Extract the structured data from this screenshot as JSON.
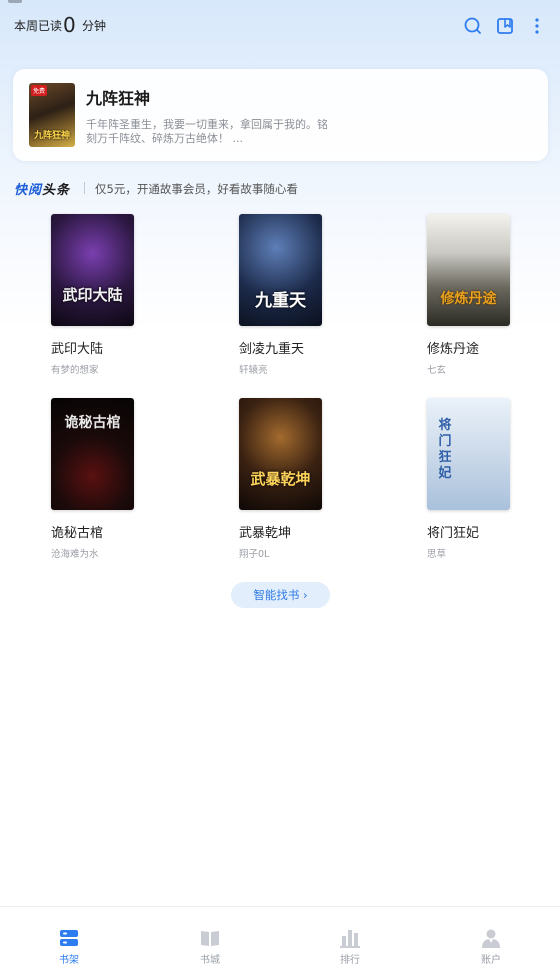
{
  "header": {
    "read_label": "本周已读",
    "read_minutes": "0",
    "read_unit": "分钟",
    "icons": [
      "search-icon",
      "bookmark-book-icon",
      "more-vertical-icon"
    ]
  },
  "banner": {
    "title": "九阵狂神",
    "description": "千年阵圣重生，我要一切重来，拿回属于我的。铭刻万千阵纹、碎炼万古绝体！ ...",
    "cover_tag": "免费",
    "cover_text": "九阵狂神"
  },
  "promo": {
    "logo_a": "快阅",
    "logo_b": "头条",
    "text": "仅5元，开通故事会员，好看故事随心看"
  },
  "books": [
    {
      "title": "武印大陆",
      "author": "有梦的想家",
      "cover_text": "武印大陆"
    },
    {
      "title": "剑凌九重天",
      "author": "轩辕亮",
      "cover_text": "九重天"
    },
    {
      "title": "修炼丹途",
      "author": "七玄",
      "cover_text": "修炼丹途"
    },
    {
      "title": "诡秘古棺",
      "author": "沧海难为水",
      "cover_text": "诡秘古棺"
    },
    {
      "title": "武暴乾坤",
      "author": "翔子0L",
      "cover_text": "武暴乾坤"
    },
    {
      "title": "将门狂妃",
      "author": "思草",
      "cover_text": "将门狂妃"
    }
  ],
  "find_button": "智能找书 ›",
  "tabs": [
    {
      "label": "书架",
      "icon": "bookshelf-icon",
      "active": true
    },
    {
      "label": "书城",
      "icon": "open-book-icon",
      "active": false
    },
    {
      "label": "排行",
      "icon": "ranking-bars-icon",
      "active": false
    },
    {
      "label": "账户",
      "icon": "account-person-icon",
      "active": false
    }
  ],
  "colors": {
    "accent": "#2d7cf0",
    "tab_inactive": "#9aa0a8",
    "header_gradient_top": "#d7e8fb"
  }
}
